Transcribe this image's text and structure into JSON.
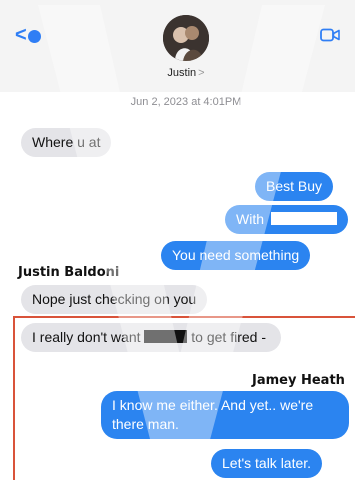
{
  "header": {
    "contact_name": "Justin",
    "contact_chevron": ">",
    "back_chevron": "<",
    "icons": [
      "back-chevron-icon",
      "unread-badge-icon",
      "avatar",
      "video-call-icon"
    ]
  },
  "timestamp": "Jun 2, 2023 at 4:01PM",
  "messages": [
    {
      "text": "Where u at"
    },
    {
      "text": "Best Buy"
    },
    {
      "text": "With"
    },
    {
      "text": "You need something"
    },
    {
      "text": "Nope just checking on you"
    },
    {
      "text_before": "I really don't want",
      "text_after": "to get fired -"
    },
    {
      "text": "I know me either.  And yet.. we're there man."
    },
    {
      "text": "Let's talk later."
    }
  ],
  "speakers": {
    "first": "Justin Baldoni",
    "second": "Jamey Heath"
  },
  "colors": {
    "accent_blue": "#2f7ef5",
    "outgoing_bubble": "#2b84f0",
    "incoming_bubble": "#e4e4e8",
    "highlight_border": "#d9533a"
  }
}
